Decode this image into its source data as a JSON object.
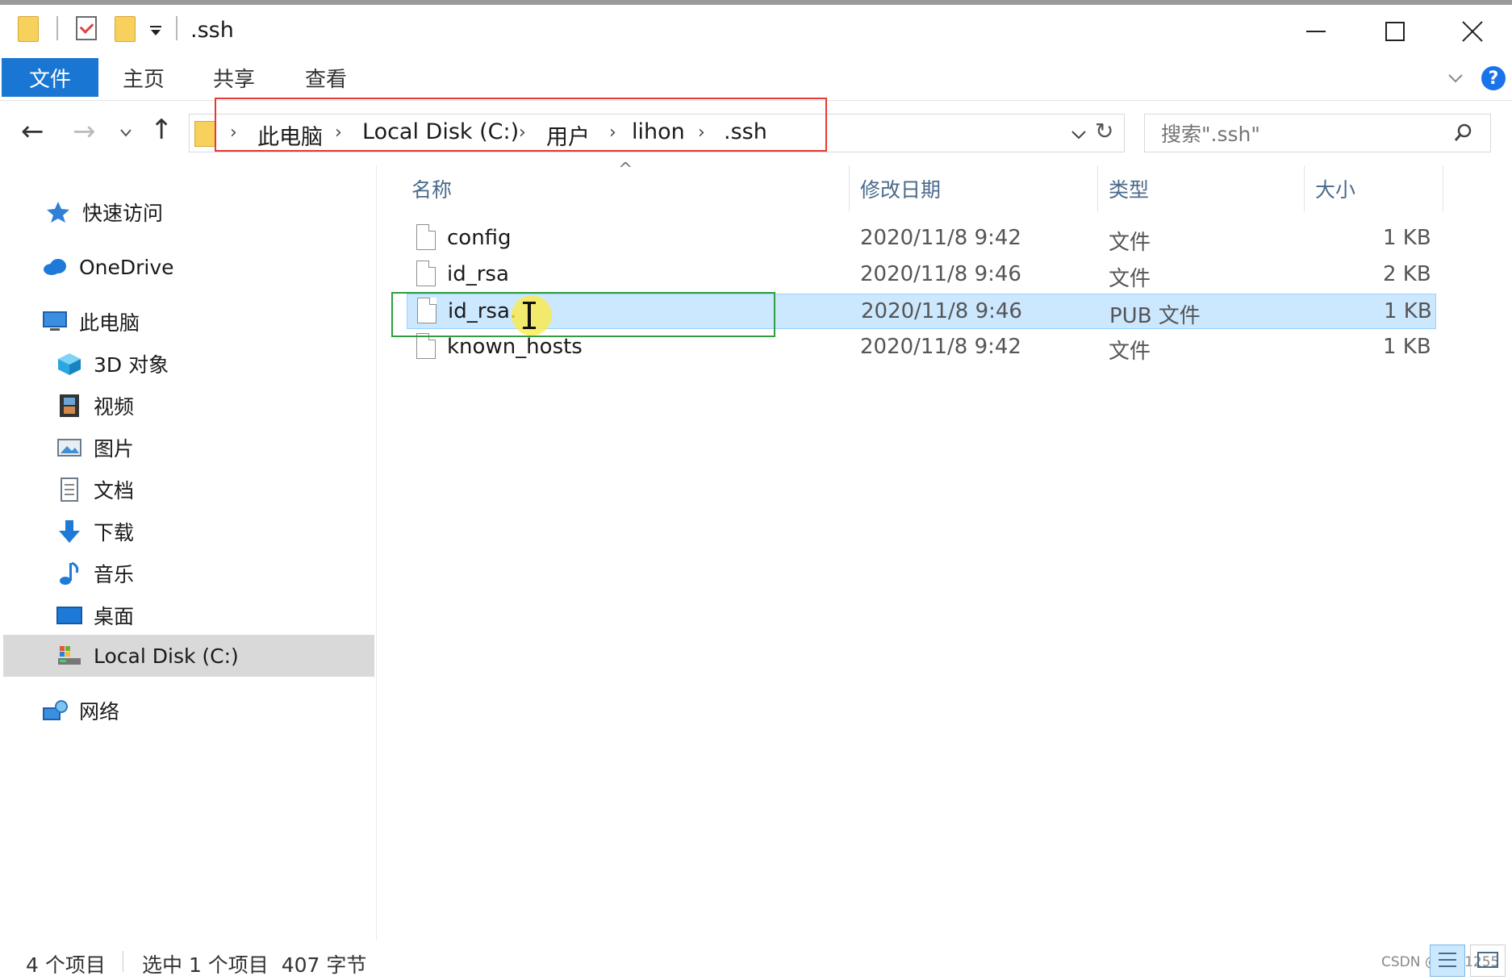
{
  "window": {
    "title": ".ssh",
    "minimize_icon": "minimize-icon",
    "maximize_icon": "maximize-icon",
    "close_icon": "close-icon"
  },
  "ribbon": {
    "tabs": [
      "文件",
      "主页",
      "共享",
      "查看"
    ],
    "help_label": "?"
  },
  "address": {
    "crumbs": [
      "此电脑",
      "Local Disk (C:)",
      "用户",
      "lihon",
      ".ssh"
    ],
    "refresh_label": "↻"
  },
  "search": {
    "placeholder": "搜索\".ssh\""
  },
  "sidebar": {
    "items": [
      {
        "label": "快速访问",
        "icon": "star-icon"
      },
      {
        "label": "OneDrive",
        "icon": "cloud-icon"
      },
      {
        "label": "此电脑",
        "icon": "computer-icon"
      },
      {
        "label": "3D 对象",
        "icon": "cube-icon"
      },
      {
        "label": "视频",
        "icon": "film-icon"
      },
      {
        "label": "图片",
        "icon": "picture-icon"
      },
      {
        "label": "文档",
        "icon": "document-icon"
      },
      {
        "label": "下载",
        "icon": "download-arrow-icon"
      },
      {
        "label": "音乐",
        "icon": "music-note-icon"
      },
      {
        "label": "桌面",
        "icon": "desktop-icon"
      },
      {
        "label": "Local Disk (C:)",
        "icon": "drive-icon"
      },
      {
        "label": "网络",
        "icon": "network-icon"
      }
    ],
    "selected": "Local Disk (C:)"
  },
  "list": {
    "columns": [
      "名称",
      "修改日期",
      "类型",
      "大小"
    ],
    "rows": [
      {
        "name": "config",
        "date": "2020/11/8 9:42",
        "type": "文件",
        "size": "1 KB"
      },
      {
        "name": "id_rsa",
        "date": "2020/11/8 9:46",
        "type": "文件",
        "size": "2 KB"
      },
      {
        "name": "id_rsa.pub",
        "name_visible": "id_rsa.",
        "date": "2020/11/8 9:46",
        "type": "PUB 文件",
        "size": "1 KB",
        "selected": true
      },
      {
        "name": "known_hosts",
        "date": "2020/11/8 9:42",
        "type": "文件",
        "size": "1 KB"
      }
    ]
  },
  "status": {
    "count": "4 个项目",
    "selection": "选中 1 个项目  407 字节",
    "watermark": "CSDN @lzy_1255"
  },
  "colors": {
    "accent": "#1976d2",
    "selection_bg": "#cce8ff",
    "annotation_red": "#e53935",
    "annotation_green": "#2e9e3e"
  }
}
